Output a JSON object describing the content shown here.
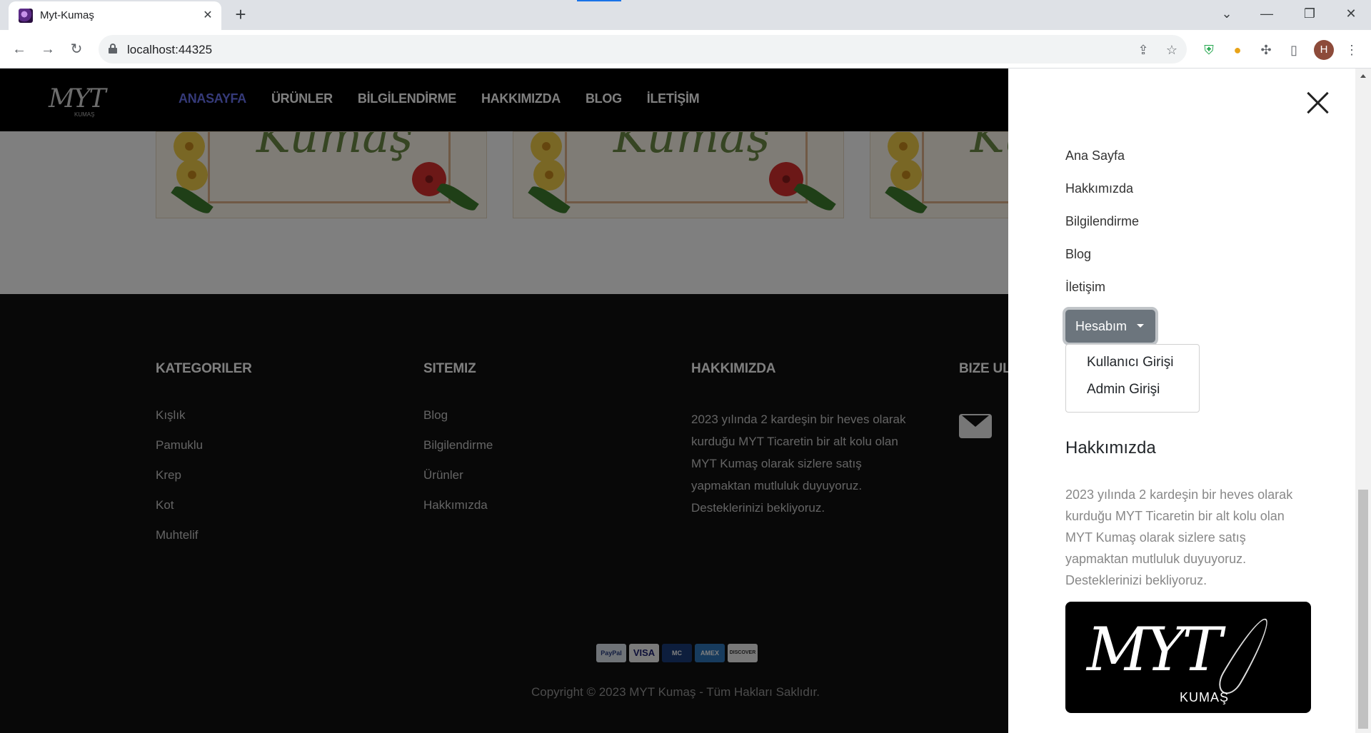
{
  "browser": {
    "tab_title": "Myt-Kumaş",
    "url": "localhost:44325",
    "profile_initial": "H",
    "icons": [
      "back-icon",
      "forward-icon",
      "reload-icon",
      "lock-icon",
      "share-icon",
      "star-icon",
      "shield-icon",
      "burger-icon",
      "puzzle-icon",
      "sidepanel-icon",
      "menu-icon"
    ]
  },
  "site": {
    "logo_text": "MYT",
    "logo_sub": "KUMAŞ",
    "nav": [
      "ANASAYFA",
      "ÜRÜNLER",
      "BİLGİLENDİRME",
      "HAKKIMIZDA",
      "BLOG",
      "İLETİŞİM"
    ],
    "banner_script": "Kumaş",
    "footer": {
      "kategoriler": {
        "title": "KATEGORILER",
        "items": [
          "Kışlık",
          "Pamuklu",
          "Krep",
          "Kot",
          "Muhtelif"
        ]
      },
      "sitemiz": {
        "title": "SITEMIZ",
        "items": [
          "Blog",
          "Bilgilendirme",
          "Ürünler",
          "Hakkımızda"
        ]
      },
      "hakkimizda": {
        "title": "HAKKIMIZDA",
        "text": "2023 yılında 2 kardeşin bir heves olarak kurduğu MYT Ticaretin bir alt kolu olan MYT Kumaş olarak sizlere satış yapmaktan mutluluk duyuyoruz. Desteklerinizi bekliyoruz."
      },
      "bize_ulasin": {
        "title": "BIZE UL"
      },
      "payments": [
        "PayPal",
        "VISA",
        "MC",
        "AMEX",
        "DISCOVER"
      ],
      "copyright": "Copyright © 2023 MYT Kumaş - Tüm Hakları Saklıdır."
    }
  },
  "offcanvas": {
    "nav": [
      "Ana Sayfa",
      "Hakkımızda",
      "Bilgilendirme",
      "Blog",
      "İletişim"
    ],
    "account_button": "Hesabım",
    "dropdown": [
      "Kullanıcı Girişi",
      "Admin Girişi"
    ],
    "about_title": "Hakkımızda",
    "about_text": "2023 yılında 2 kardeşin bir heves olarak kurduğu MYT Ticaretin bir alt kolu olan MYT Kumaş olarak sizlere satış yapmaktan mutluluk duyuyoruz. Desteklerinizi bekliyoruz.",
    "logo_text": "MYT",
    "logo_sub": "KUMAŞ"
  },
  "colors": {
    "nav_active": "#6b74f2",
    "header_bg": "#000000",
    "footer_bg": "#111111",
    "account_button": "#6c757d"
  }
}
